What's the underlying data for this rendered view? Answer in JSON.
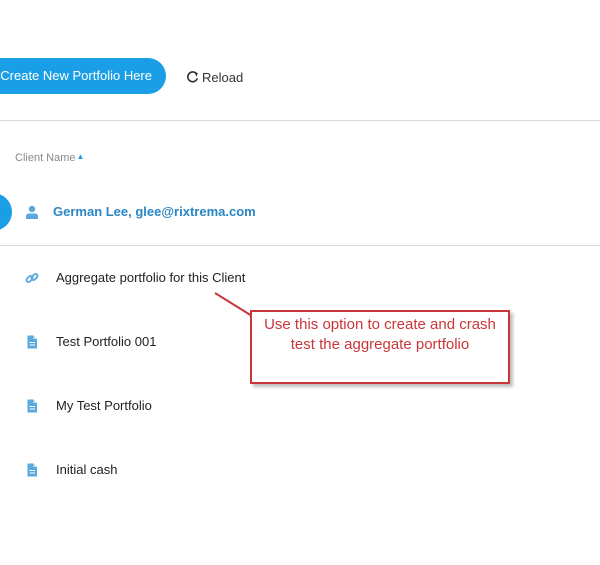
{
  "toolbar": {
    "create_label": "Create New Portfolio Here",
    "reload_label": "Reload"
  },
  "table": {
    "column_header": "Client Name"
  },
  "client": {
    "label": "German Lee, glee@rixtrema.com"
  },
  "portfolios": [
    {
      "label": "Aggregate portfolio for this Client",
      "icon": "link-icon"
    },
    {
      "label": "Test Portfolio 001",
      "icon": "document-icon"
    },
    {
      "label": "My Test Portfolio",
      "icon": "document-icon"
    },
    {
      "label": "Initial cash",
      "icon": "document-icon"
    }
  ],
  "annotation": {
    "text": "Use this option to create and crash test the aggregate portfolio"
  },
  "colors": {
    "accent": "#1a9fe6",
    "client_text": "#2a86c4",
    "callout": "#c9363a",
    "icon": "#5aa9de"
  }
}
